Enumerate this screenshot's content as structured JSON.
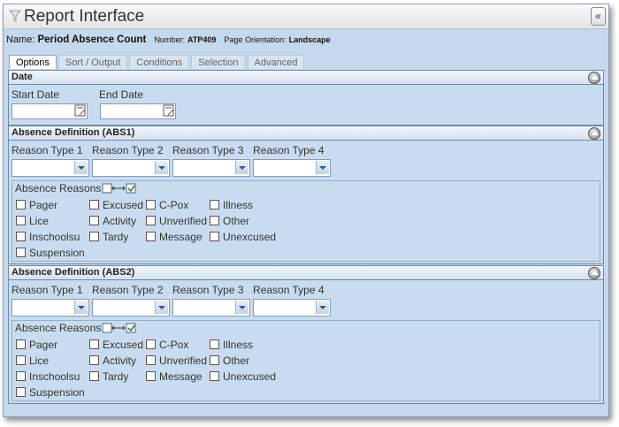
{
  "window": {
    "title": "Report Interface",
    "collapse_glyph": "«"
  },
  "report": {
    "name_label": "Name:",
    "name_value": "Period Absence Count",
    "number_label": "Number:",
    "number_value": "ATP409",
    "orientation_label": "Page Orientation:",
    "orientation_value": "Landscape"
  },
  "tabs": [
    "Options",
    "Sort / Output",
    "Conditions",
    "Selection",
    "Advanced"
  ],
  "date_section": {
    "title": "Date",
    "start_label": "Start Date",
    "end_label": "End Date"
  },
  "abs1": {
    "title": "Absence Definition (ABS1)",
    "type_labels": [
      "Reason Type 1",
      "Reason Type 2",
      "Reason Type 3",
      "Reason Type 4"
    ],
    "reasons_title": "Absence Reasons",
    "reasons": [
      "Pager",
      "Excused",
      "C-Pox",
      "Illness",
      "Lice",
      "Activity",
      "Unverified",
      "Other",
      "Inschoolsu",
      "Tardy",
      "Message",
      "Unexcused",
      "Suspension"
    ]
  },
  "abs2": {
    "title": "Absence Definition (ABS2)",
    "type_labels": [
      "Reason Type 1",
      "Reason Type 2",
      "Reason Type 3",
      "Reason Type 4"
    ],
    "reasons_title": "Absence Reasons",
    "reasons": [
      "Pager",
      "Excused",
      "C-Pox",
      "Illness",
      "Lice",
      "Activity",
      "Unverified",
      "Other",
      "Inschoolsu",
      "Tardy",
      "Message",
      "Unexcused",
      "Suspension"
    ]
  },
  "icons": {
    "title": "funnel-icon",
    "calendar": "calendar-icon",
    "toggle": "collapse-section-icon",
    "select_all": "select-all-toggle-icon"
  }
}
